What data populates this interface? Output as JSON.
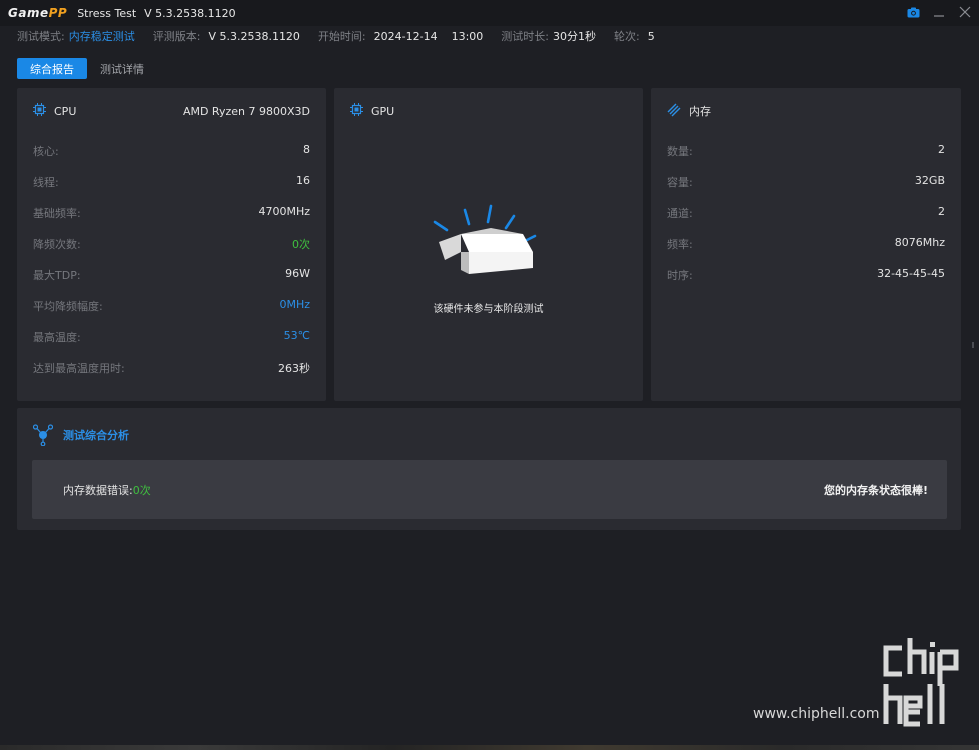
{
  "titlebar": {
    "logo_game": "Game",
    "logo_pp": "PP",
    "app_name": "Stress Test",
    "version": "V 5.3.2538.1120",
    "controls": [
      "camera-icon",
      "minimize-icon",
      "close-icon"
    ]
  },
  "info": {
    "mode_label": "测试模式:",
    "mode_value": "内存稳定测试",
    "eval_label": "评测版本:",
    "eval_value": "V 5.3.2538.1120",
    "start_label": "开始时间:",
    "start_value": "2024-12-14    13:00",
    "duration_label": "测试时长:",
    "duration_value": "30分1秒",
    "rounds_label": "轮次:",
    "rounds_value": "5"
  },
  "tabs": [
    {
      "label": "综合报告",
      "active": true
    },
    {
      "label": "测试详情",
      "active": false
    }
  ],
  "cpu": {
    "title": "CPU",
    "model": "AMD Ryzen 7 9800X3D",
    "rows": [
      {
        "k": "核心:",
        "v": "8"
      },
      {
        "k": "线程:",
        "v": "16"
      },
      {
        "k": "基础频率:",
        "v": "4700MHz"
      },
      {
        "k": "降频次数:",
        "v": "0次"
      },
      {
        "k": "最大TDP:",
        "v": "96W"
      },
      {
        "k": "平均降频幅度:",
        "v": "0MHz"
      },
      {
        "k": "最高温度:",
        "v": "53℃"
      },
      {
        "k": "达到最高温度用时:",
        "v": "263秒"
      }
    ]
  },
  "gpu": {
    "title": "GPU",
    "empty_message": "该硬件未参与本阶段测试"
  },
  "memory": {
    "title": "内存",
    "rows": [
      {
        "k": "数量:",
        "v": "2"
      },
      {
        "k": "容量:",
        "v": "32GB"
      },
      {
        "k": "通道:",
        "v": "2"
      },
      {
        "k": "频率:",
        "v": "8076Mhz"
      },
      {
        "k": "时序:",
        "v": "32-45-45-45"
      }
    ]
  },
  "analysis": {
    "title": "测试综合分析",
    "error_label": "内存数据错误:",
    "error_value": "0次",
    "verdict": "您的内存条状态很棒!"
  },
  "watermark": {
    "url": "www.chiphell.com"
  },
  "colors": {
    "accent": "#1a88e6",
    "ok": "#3fbf3f",
    "brand": "#f0a020"
  }
}
